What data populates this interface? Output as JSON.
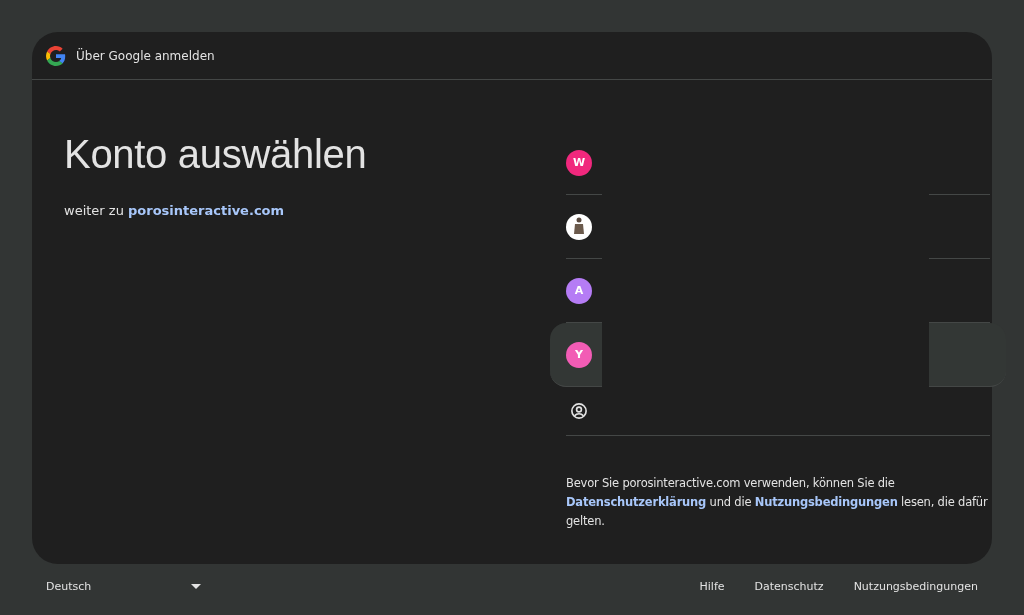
{
  "header": {
    "title": "Über Google anmelden"
  },
  "heading": "Konto auswählen",
  "subtitle": {
    "prefix": "weiter zu",
    "link": "porosinteractive.com"
  },
  "accounts": [
    {
      "kind": "letter",
      "initial": "W",
      "color": "#f0287d",
      "highlighted": false
    },
    {
      "kind": "photo",
      "highlighted": false
    },
    {
      "kind": "letter",
      "initial": "A",
      "color": "#b57cf5",
      "highlighted": false
    },
    {
      "kind": "letter",
      "initial": "Y",
      "color": "#f25cb5",
      "highlighted": true
    },
    {
      "kind": "other",
      "highlighted": false
    }
  ],
  "notice": [
    {
      "kind": "text",
      "text": "Bevor Sie porosinteractive.com verwenden, können Sie die "
    },
    {
      "kind": "link",
      "text": "Datenschutzerklärung"
    },
    {
      "kind": "text",
      "text": " und die "
    },
    {
      "kind": "link",
      "text": "Nutzungsbedingungen"
    },
    {
      "kind": "text",
      "text": " lesen, die dafür gelten."
    }
  ],
  "footer": {
    "language": "Deutsch",
    "links": [
      "Hilfe",
      "Datenschutz",
      "Nutzungsbedingungen"
    ]
  }
}
